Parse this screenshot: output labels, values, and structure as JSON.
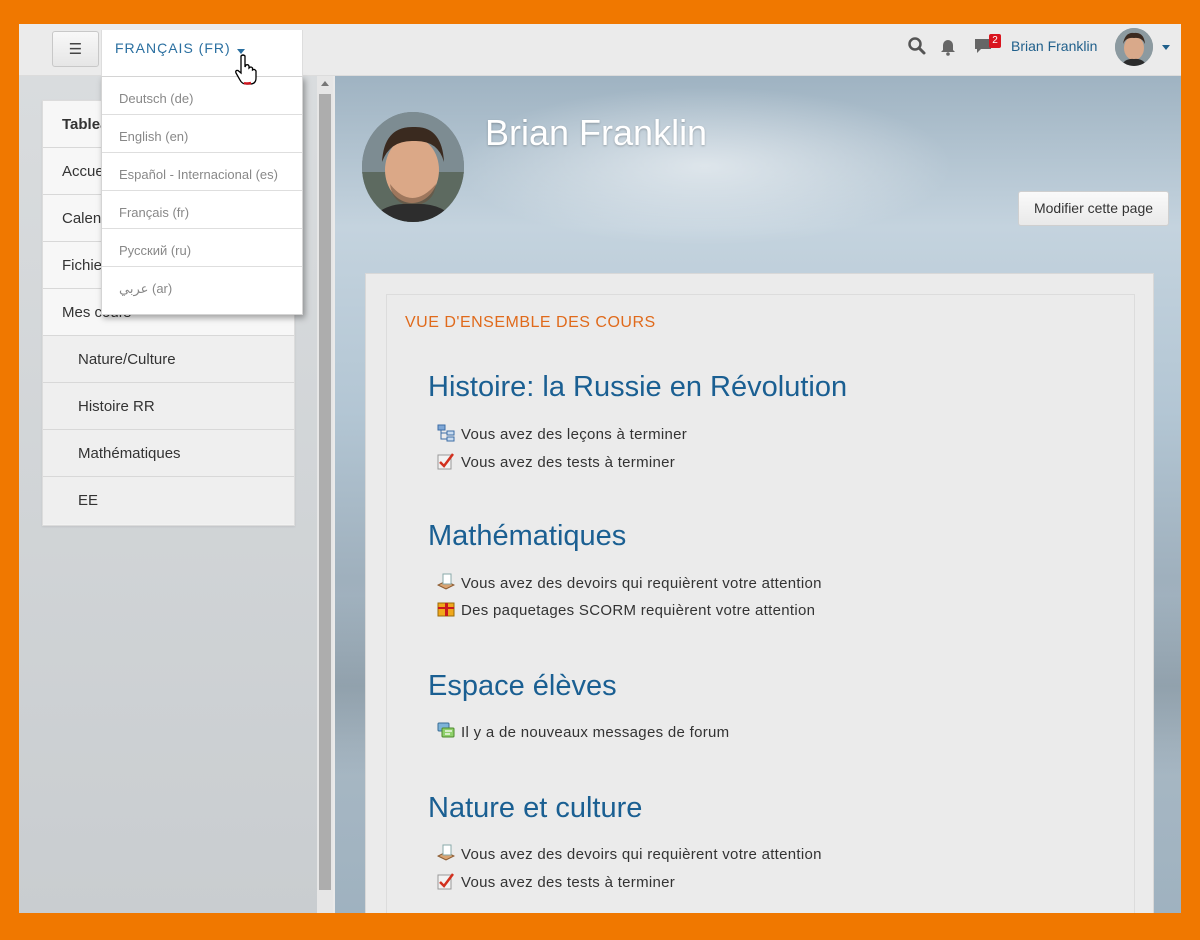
{
  "navbar": {
    "menu_glyph": "☰",
    "language_label": "FRANÇAIS (FR)",
    "message_count": "2",
    "user_name": "Brian Franklin"
  },
  "language_menu": {
    "options": [
      "Deutsch (de)",
      "English (en)",
      "Español - Internacional (es)",
      "Français (fr)",
      "Русский (ru)",
      "عربي (ar)"
    ]
  },
  "sidebar": {
    "items": [
      "Tableau de bord",
      "Accueil du site",
      "Calendrier",
      "Fichiers personnels",
      "Mes cours"
    ],
    "courses": [
      "Nature/Culture",
      "Histoire RR",
      "Mathématiques",
      "EE"
    ]
  },
  "profile": {
    "name": "Brian Franklin",
    "edit_button": "Modifier cette page"
  },
  "overview": {
    "title": "VUE D'ENSEMBLE DES COURS",
    "courses": [
      {
        "name": "Histoire: la Russie en Révolution",
        "alerts": [
          {
            "icon": "lesson-icon",
            "text": "Vous avez des leçons à terminer"
          },
          {
            "icon": "quiz-icon",
            "text": "Vous avez des tests à terminer"
          }
        ]
      },
      {
        "name": "Mathématiques",
        "alerts": [
          {
            "icon": "assignment-icon",
            "text": "Vous avez des devoirs qui requièrent votre attention"
          },
          {
            "icon": "scorm-icon",
            "text": "Des paquetages SCORM requièrent votre attention"
          }
        ]
      },
      {
        "name": "Espace élèves",
        "alerts": [
          {
            "icon": "forum-icon",
            "text": "Il y a de nouveaux messages de forum"
          }
        ]
      },
      {
        "name": "Nature et culture",
        "alerts": [
          {
            "icon": "assignment-icon",
            "text": "Vous avez des devoirs qui requièrent votre attention"
          },
          {
            "icon": "quiz-icon",
            "text": "Vous avez des tests à terminer"
          }
        ]
      }
    ]
  },
  "colors": {
    "frame": "#f07800",
    "link": "#1a5f92",
    "accent": "#e06a1b",
    "badge": "#d9141e"
  }
}
